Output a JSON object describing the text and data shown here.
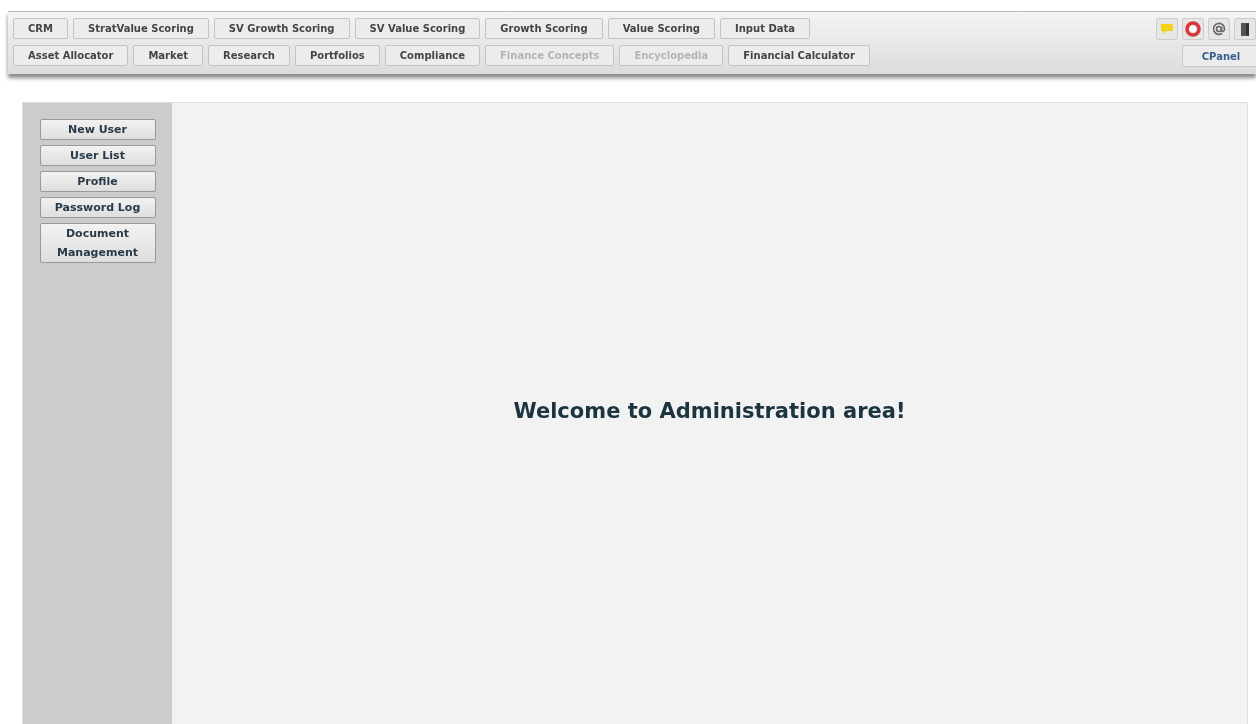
{
  "nav_rows": [
    [
      {
        "label": "CRM",
        "disabled": false
      },
      {
        "label": "StratValue Scoring",
        "disabled": false
      },
      {
        "label": "SV Growth Scoring",
        "disabled": false
      },
      {
        "label": "SV Value Scoring",
        "disabled": false
      },
      {
        "label": "Growth Scoring",
        "disabled": false
      },
      {
        "label": "Value Scoring",
        "disabled": false
      },
      {
        "label": "Input Data",
        "disabled": false
      }
    ],
    [
      {
        "label": "Asset Allocator",
        "disabled": false
      },
      {
        "label": "Market",
        "disabled": false
      },
      {
        "label": "Research",
        "disabled": false
      },
      {
        "label": "Portfolios",
        "disabled": false
      },
      {
        "label": "Compliance",
        "disabled": false
      },
      {
        "label": "Finance Concepts",
        "disabled": true
      },
      {
        "label": "Encyclopedia",
        "disabled": true
      },
      {
        "label": "Financial Calculator",
        "disabled": false
      }
    ]
  ],
  "tool_icons": [
    {
      "kind": "chat"
    },
    {
      "kind": "help"
    },
    {
      "kind": "email"
    },
    {
      "kind": "logout"
    }
  ],
  "cpanel": "CPanel",
  "sidebar": {
    "items": [
      {
        "label": "New User"
      },
      {
        "label": "User List"
      },
      {
        "label": "Profile"
      },
      {
        "label": "Password Log"
      },
      {
        "label": "Document Management"
      }
    ]
  },
  "welcome": "Welcome to Administration area!"
}
